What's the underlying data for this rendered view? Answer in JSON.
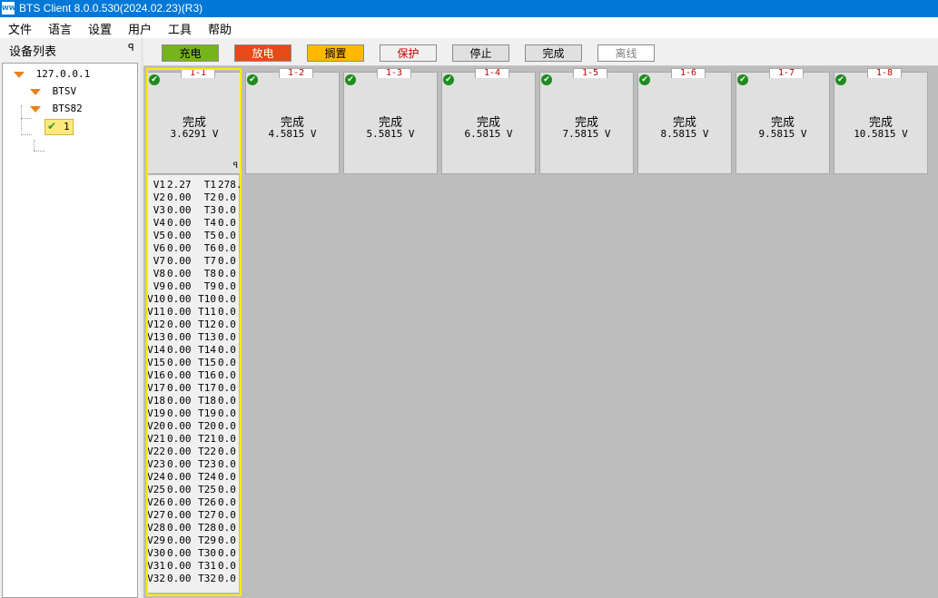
{
  "titlebar": {
    "icon": "WW",
    "title": "BTS Client 8.0.0.530(2024.02.23)(R3)"
  },
  "menu": [
    "文件",
    "语言",
    "设置",
    "用户",
    "工具",
    "帮助"
  ],
  "device_list": {
    "header": "设备列表",
    "pin": "ꟼ",
    "nodes": [
      {
        "label": "127.0.0.1"
      },
      {
        "label": "BTSV"
      },
      {
        "label": "BTS82"
      },
      {
        "label": "1"
      }
    ]
  },
  "legend": [
    {
      "label": "充电",
      "bg": "#77b41c",
      "fg": "#000000"
    },
    {
      "label": "放电",
      "bg": "#e64a19",
      "fg": "#ffffff"
    },
    {
      "label": "搁置",
      "bg": "#ffb900",
      "fg": "#000000"
    },
    {
      "label": "保护",
      "bg": "#f0f0f0",
      "fg": "#c00000"
    },
    {
      "label": "停止",
      "bg": "#e0e0e0",
      "fg": "#000000"
    },
    {
      "label": "完成",
      "bg": "#e0e0e0",
      "fg": "#000000"
    },
    {
      "label": "离线",
      "bg": "#ffffff",
      "fg": "#808080"
    }
  ],
  "channels": [
    {
      "id": "1-1",
      "status": "完成",
      "voltage": "3.6291 V"
    },
    {
      "id": "1-2",
      "status": "完成",
      "voltage": "4.5815 V"
    },
    {
      "id": "1-3",
      "status": "完成",
      "voltage": "5.5815 V"
    },
    {
      "id": "1-4",
      "status": "完成",
      "voltage": "6.5815 V"
    },
    {
      "id": "1-5",
      "status": "完成",
      "voltage": "7.5815 V"
    },
    {
      "id": "1-6",
      "status": "完成",
      "voltage": "8.5815 V"
    },
    {
      "id": "1-7",
      "status": "完成",
      "voltage": "9.5815 V"
    },
    {
      "id": "1-8",
      "status": "完成",
      "voltage": "10.5815 V"
    }
  ],
  "card_pin": "ꟼ",
  "status_icon": "check-circle-icon",
  "detail_rows": [
    {
      "v": "V1",
      "vv": "2.27",
      "t": "T1",
      "tv": "278."
    },
    {
      "v": "V2",
      "vv": "0.00",
      "t": "T2",
      "tv": "0.0"
    },
    {
      "v": "V3",
      "vv": "0.00",
      "t": "T3",
      "tv": "0.0"
    },
    {
      "v": "V4",
      "vv": "0.00",
      "t": "T4",
      "tv": "0.0"
    },
    {
      "v": "V5",
      "vv": "0.00",
      "t": "T5",
      "tv": "0.0"
    },
    {
      "v": "V6",
      "vv": "0.00",
      "t": "T6",
      "tv": "0.0"
    },
    {
      "v": "V7",
      "vv": "0.00",
      "t": "T7",
      "tv": "0.0"
    },
    {
      "v": "V8",
      "vv": "0.00",
      "t": "T8",
      "tv": "0.0"
    },
    {
      "v": "V9",
      "vv": "0.00",
      "t": "T9",
      "tv": "0.0"
    },
    {
      "v": "V10",
      "vv": "0.00",
      "t": "T10",
      "tv": "0.0"
    },
    {
      "v": "V11",
      "vv": "0.00",
      "t": "T11",
      "tv": "0.0"
    },
    {
      "v": "V12",
      "vv": "0.00",
      "t": "T12",
      "tv": "0.0"
    },
    {
      "v": "V13",
      "vv": "0.00",
      "t": "T13",
      "tv": "0.0"
    },
    {
      "v": "V14",
      "vv": "0.00",
      "t": "T14",
      "tv": "0.0"
    },
    {
      "v": "V15",
      "vv": "0.00",
      "t": "T15",
      "tv": "0.0"
    },
    {
      "v": "V16",
      "vv": "0.00",
      "t": "T16",
      "tv": "0.0"
    },
    {
      "v": "V17",
      "vv": "0.00",
      "t": "T17",
      "tv": "0.0"
    },
    {
      "v": "V18",
      "vv": "0.00",
      "t": "T18",
      "tv": "0.0"
    },
    {
      "v": "V19",
      "vv": "0.00",
      "t": "T19",
      "tv": "0.0"
    },
    {
      "v": "V20",
      "vv": "0.00",
      "t": "T20",
      "tv": "0.0"
    },
    {
      "v": "V21",
      "vv": "0.00",
      "t": "T21",
      "tv": "0.0"
    },
    {
      "v": "V22",
      "vv": "0.00",
      "t": "T22",
      "tv": "0.0"
    },
    {
      "v": "V23",
      "vv": "0.00",
      "t": "T23",
      "tv": "0.0"
    },
    {
      "v": "V24",
      "vv": "0.00",
      "t": "T24",
      "tv": "0.0"
    },
    {
      "v": "V25",
      "vv": "0.00",
      "t": "T25",
      "tv": "0.0"
    },
    {
      "v": "V26",
      "vv": "0.00",
      "t": "T26",
      "tv": "0.0"
    },
    {
      "v": "V27",
      "vv": "0.00",
      "t": "T27",
      "tv": "0.0"
    },
    {
      "v": "V28",
      "vv": "0.00",
      "t": "T28",
      "tv": "0.0"
    },
    {
      "v": "V29",
      "vv": "0.00",
      "t": "T29",
      "tv": "0.0"
    },
    {
      "v": "V30",
      "vv": "0.00",
      "t": "T30",
      "tv": "0.0"
    },
    {
      "v": "V31",
      "vv": "0.00",
      "t": "T31",
      "tv": "0.0"
    },
    {
      "v": "V32",
      "vv": "0.00",
      "t": "T32",
      "tv": "0.0"
    }
  ]
}
